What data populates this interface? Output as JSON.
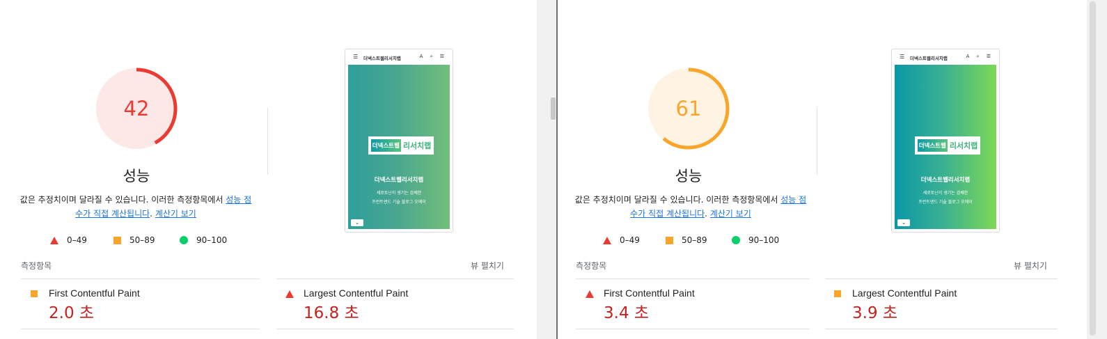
{
  "colors": {
    "fail": "#eb3a32",
    "average": "#f8a52a",
    "pass": "#0cce6b",
    "metric_value": "#c5221f",
    "link": "#1a73e8"
  },
  "reports": [
    {
      "score": 42,
      "score_fraction": 0.42,
      "rating": "fail",
      "category_title": "성능",
      "description": {
        "text": "값은 추정치이며 달라질 수 있습니다. 이러한 측정항목에서 ",
        "link_text": "성능 점수가 직접 계산됩니다",
        "sep": ". ",
        "calc_link": "계산기 보기"
      },
      "legend": [
        {
          "range": "0–49",
          "icon": "triangle-icon"
        },
        {
          "range": "50–89",
          "icon": "square-icon"
        },
        {
          "range": "90–100",
          "icon": "circle-icon"
        }
      ],
      "screenshot": {
        "site_title": "더넥스트웹리서치랩",
        "logo_left": "더넥스트웹",
        "logo_right": "리서치랩",
        "heading": "더넥스트웹리서치랩",
        "subtitle_1": "세로토닌이 생기는 감쎄한",
        "subtitle_2": "프런트엔드 기술 블로그 오에이"
      },
      "metrics_label": "측정항목",
      "expand_label": "뷰 펼치기",
      "metrics": [
        {
          "name": "First Contentful Paint",
          "value": "2.0 초",
          "rating": "average"
        },
        {
          "name": "Largest Contentful Paint",
          "value": "16.8 초",
          "rating": "fail"
        }
      ]
    },
    {
      "score": 61,
      "score_fraction": 0.61,
      "rating": "average",
      "category_title": "성능",
      "description": {
        "text": "값은 추정치이며 달라질 수 있습니다. 이러한 측정항목에서 ",
        "link_text": "성능 점수가 직접 계산됩니다",
        "sep": ". ",
        "calc_link": "계산기 보기"
      },
      "legend": [
        {
          "range": "0–49",
          "icon": "triangle-icon"
        },
        {
          "range": "50–89",
          "icon": "square-icon"
        },
        {
          "range": "90–100",
          "icon": "circle-icon"
        }
      ],
      "screenshot": {
        "site_title": "더넥스트웹리서치랩",
        "logo_left": "더넥스트웹",
        "logo_right": "리서치랩",
        "heading": "더넥스트웹리서치랩",
        "subtitle_1": "세로토닌이 생기는 감쎄한",
        "subtitle_2": "프런트엔드 기술 블로그 오에이"
      },
      "metrics_label": "측정항목",
      "expand_label": "뷰 펼치기",
      "metrics": [
        {
          "name": "First Contentful Paint",
          "value": "3.4 초",
          "rating": "fail"
        },
        {
          "name": "Largest Contentful Paint",
          "value": "3.9 초",
          "rating": "average"
        }
      ]
    }
  ]
}
